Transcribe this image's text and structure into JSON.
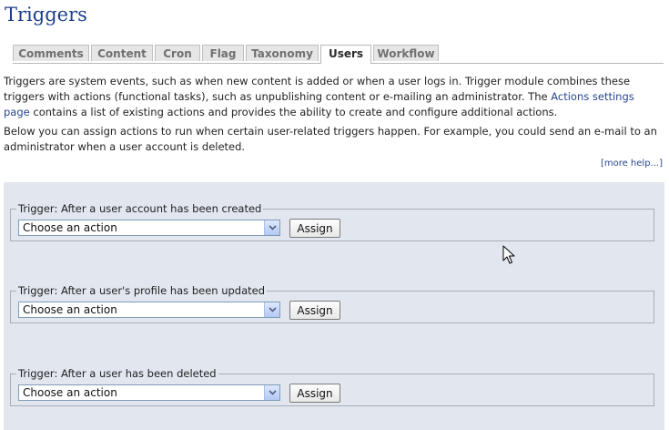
{
  "page": {
    "title": "Triggers"
  },
  "tabs": [
    {
      "label": "Comments"
    },
    {
      "label": "Content"
    },
    {
      "label": "Cron"
    },
    {
      "label": "Flag"
    },
    {
      "label": "Taxonomy"
    },
    {
      "label": "Users",
      "active": true
    },
    {
      "label": "Workflow"
    }
  ],
  "description": {
    "p1_before_link": "Triggers are system events, such as when new content is added or when a user logs in. Trigger module combines these triggers with actions (functional tasks), such as unpublishing content or e-mailing an administrator. The ",
    "p1_link": "Actions settings page",
    "p1_after_link": " contains a list of existing actions and provides the ability to create and configure additional actions.",
    "p2": "Below you can assign actions to run when certain user-related triggers happen. For example, you could send an e-mail to an administrator when a user account is deleted."
  },
  "more_help": "[more help...]",
  "triggers": [
    {
      "legend": "Trigger: After a user account has been created",
      "select_value": "Choose an action",
      "button_label": "Assign"
    },
    {
      "legend": "Trigger: After a user's profile has been updated",
      "select_value": "Choose an action",
      "button_label": "Assign"
    },
    {
      "legend": "Trigger: After a user has been deleted",
      "select_value": "Choose an action",
      "button_label": "Assign"
    }
  ],
  "colors": {
    "link": "#27468d",
    "title": "#1f3f8f",
    "panel_bg": "#e1e6ef"
  }
}
